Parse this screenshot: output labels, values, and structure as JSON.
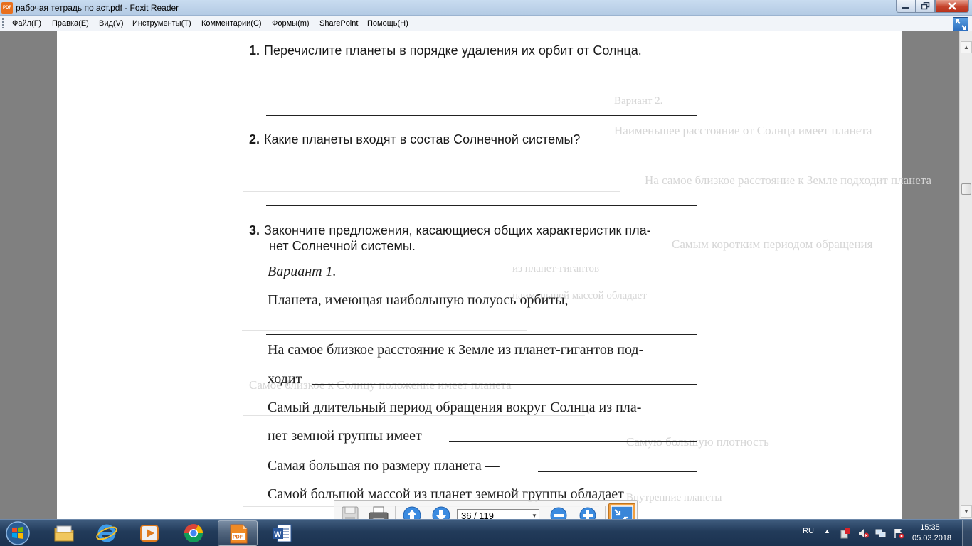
{
  "window": {
    "title": "рабочая тетрадь по аст.pdf - Foxit Reader",
    "app_icon_text": "PDF"
  },
  "menu": [
    "Файл(F)",
    "Правка(E)",
    "Вид(V)",
    "Инструменты(T)",
    "Комментарии(C)",
    "Формы(m)",
    "SharePoint",
    "Помощь(H)"
  ],
  "document": {
    "q1": {
      "num": "1.",
      "text": "Перечислите планеты в порядке удаления их орбит от Солнца."
    },
    "q2": {
      "num": "2.",
      "text": "Какие планеты входят в состав Солнечной системы?"
    },
    "q3": {
      "num": "3.",
      "line1": "Закончите предложения, касающиеся общих характеристик пла-",
      "line2": "нет Солнечной системы."
    },
    "variant": "Вариант 1.",
    "sentences": {
      "s1": "Планета, имеющая наибольшую полуось орбиты, —",
      "s2a": "На самое близкое расстояние к Земле из планет-гигантов под-",
      "s2b": "ходит",
      "s3a": "Самый длительный период обращения вокруг Солнца из пла-",
      "s3b": "нет земной группы имеет",
      "s4": "Самая большая по размеру планета —",
      "s5": "Самой большой массой из планет земной группы обладает"
    },
    "show_through": {
      "g1": "Вариант 2.",
      "g2": "Наименьшее расстояние от Солнца имеет планета",
      "g3": "На самое близкое расстояние к Земле подходит планета",
      "g4": "Самым коротким периодом обращения",
      "g5": "из планет-гигантов",
      "g6": "наименьшей массой обладает",
      "g7": "Самое близкое к Солнцу положение имеет планета",
      "g8": "Самую большую плотность",
      "g9": "Внутренние планеты"
    }
  },
  "float_toolbar": {
    "page_indicator": "36 / 119",
    "buttons": [
      "save",
      "print",
      "previous-page",
      "next-page",
      "zoom-out",
      "zoom-in",
      "exit-full-screen"
    ]
  },
  "taskbar": {
    "apps": [
      "file-explorer",
      "internet-explorer",
      "media-player",
      "chrome",
      "foxit-reader",
      "word"
    ],
    "active_app": "foxit-reader",
    "language": "RU",
    "time": "15:35",
    "date": "05.03.2018"
  },
  "colors": {
    "titlebar": "#c9dcf0",
    "taskbar": "#223b5a",
    "toolbar_accent": "#f1a041",
    "nav_blue": "#3b8be0"
  }
}
